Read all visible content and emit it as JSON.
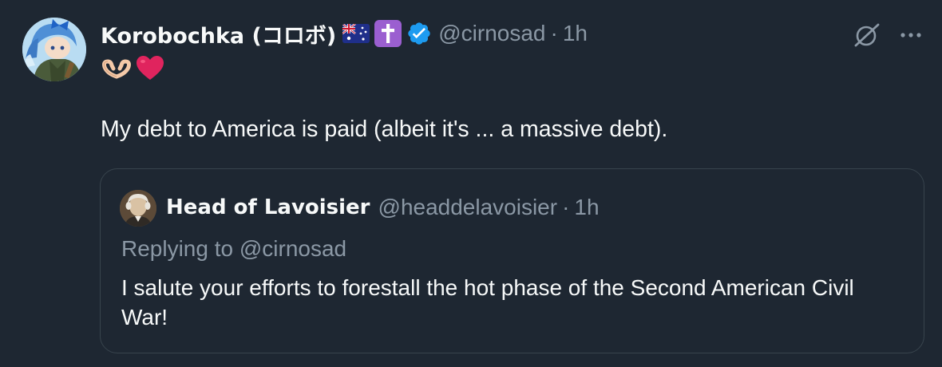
{
  "tweet": {
    "display_name": "Korobochka (コロボ)",
    "flag_emoji": "australia-flag-emoji",
    "cross_emoji": "latin-cross-emoji",
    "verified_badge": "verified-badge-icon",
    "handle": "@cirnosad",
    "separator": "·",
    "time": "1h",
    "emojis": [
      "heart-hands-emoji",
      "red-heart-emoji"
    ],
    "text": "My debt to America is paid (albeit it's ... a massive debt)."
  },
  "actions": {
    "icons": [
      "grok-icon",
      "more-options-icon"
    ]
  },
  "quote": {
    "display_name": "Head of Lavoisier",
    "handle": "@headdelavoisier",
    "separator": "·",
    "time": "1h",
    "replying_to": "Replying to @cirnosad",
    "text": "I salute your efforts to forestall the hot phase of the Second American Civil War!"
  },
  "colors": {
    "background": "#1e2732",
    "primary_text": "#f7f9f9",
    "secondary_text": "#8b98a5",
    "border": "#38444d",
    "verified_blue": "#1d9bf0",
    "heart_red": "#e0245e"
  }
}
